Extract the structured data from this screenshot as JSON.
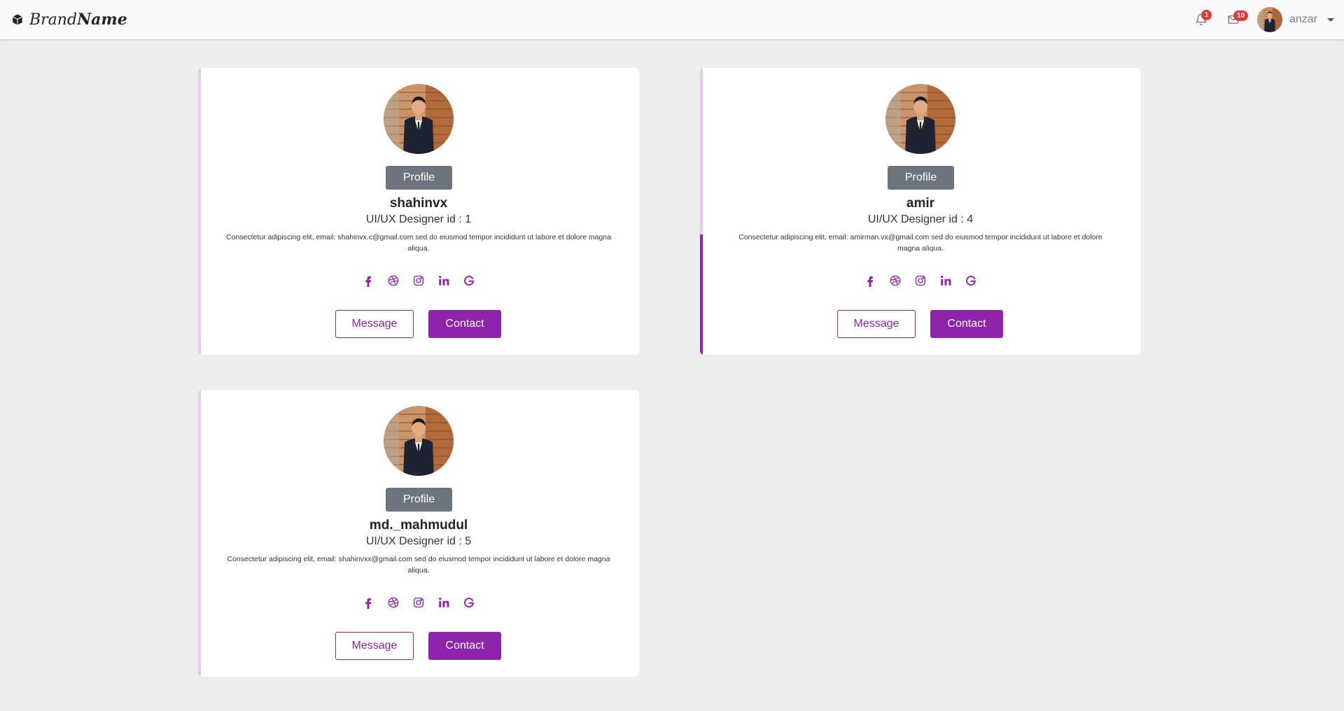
{
  "navbar": {
    "brand_light": "Brand",
    "brand_bold": "Name",
    "notifications_count": "1",
    "messages_count": "10",
    "username": "anzar"
  },
  "profiles": [
    {
      "profile_label": "Profile",
      "name": "shahinvx",
      "role": "UI/UX Designer id : 1",
      "description": "Consectetur adipiscing elit, email: shahinvx.c@gmail.com sed do eiusmod tempor incididunt ut labore et dolore magna aliqua.",
      "message_label": "Message",
      "contact_label": "Contact"
    },
    {
      "profile_label": "Profile",
      "name": "amir",
      "role": "UI/UX Designer id : 4",
      "description": "Consectetur adipiscing elit, email: amirman.vx@gmail.com sed do eiusmod tempor incididunt ut labore et dolore magna aliqua.",
      "message_label": "Message",
      "contact_label": "Contact"
    },
    {
      "profile_label": "Profile",
      "name": "md._mahmudul",
      "role": "UI/UX Designer id : 5",
      "description": "Consectetur adipiscing elit, email: shahinvxx@gmail.com sed do eiusmod tempor incididunt ut labore et dolore magna aliqua.",
      "message_label": "Message",
      "contact_label": "Contact"
    }
  ],
  "social_icons": [
    "facebook-icon",
    "dribbble-icon",
    "instagram-icon",
    "linkedin-icon",
    "google-icon"
  ],
  "colors": {
    "accent": "#8e24aa",
    "accent_light": "#e8c8ef",
    "badge": "#e53935",
    "profile_button": "#6c757d",
    "background": "#ededed"
  }
}
